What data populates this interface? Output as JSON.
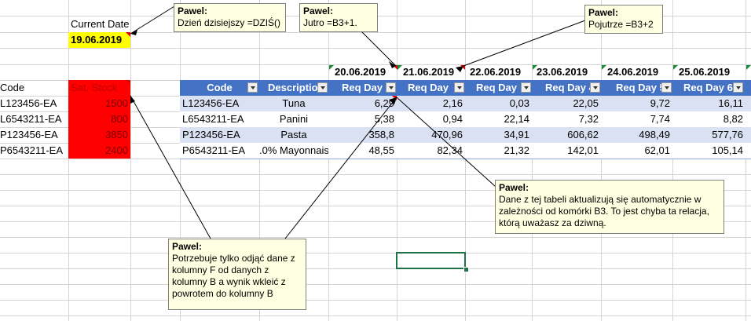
{
  "current_date_label": "Current Date",
  "current_date_value": "19.06.2019",
  "left_table": {
    "headers": [
      "Code",
      "Sat. Stock"
    ],
    "rows": [
      {
        "code": "L123456-EA",
        "stock": "1500"
      },
      {
        "code": "L6543211-EA",
        "stock": "800"
      },
      {
        "code": "P123456-EA",
        "stock": "3850"
      },
      {
        "code": "P6543211-EA",
        "stock": "2400"
      }
    ]
  },
  "dates": [
    "20.06.2019",
    "21.06.2019",
    "22.06.2019",
    "23.06.2019",
    "24.06.2019",
    "25.06.2019"
  ],
  "main_table": {
    "headers": [
      "Code",
      "Descriptio",
      "Req Day",
      "Req Day",
      "Req Day",
      "Req Day 4",
      "Req Day 5",
      "Req Day 6"
    ],
    "rows": [
      {
        "code": "L123456-EA",
        "desc": "Tuna",
        "vals": [
          "6,29",
          "2,16",
          "0,03",
          "22,05",
          "9,72",
          "16,11"
        ]
      },
      {
        "code": "L6543211-EA",
        "desc": "Panini",
        "vals": [
          "5,38",
          "0,94",
          "22,14",
          "7,32",
          "7,74",
          "8,82"
        ]
      },
      {
        "code": "P123456-EA",
        "desc": "Pasta",
        "vals": [
          "358,8",
          "470,96",
          "34,91",
          "606,62",
          "498,49",
          "577,76"
        ]
      },
      {
        "code": "P6543211-EA",
        "desc": ".0% Mayonnais",
        "vals": [
          "48,55",
          "82,34",
          "21,32",
          "142,01",
          "62,01",
          "105,14"
        ]
      }
    ]
  },
  "comments": [
    {
      "author": "Pawel:",
      "text": "Dzień dzisiejszy =DZIŚ()"
    },
    {
      "author": "Pawel:",
      "text": "Jutro =B3+1."
    },
    {
      "author": "Pawel:",
      "text": "Pojutrze =B3+2"
    },
    {
      "author": "Pawel:",
      "text": "Dane z tej tabeli aktualizują się automatycznie w zależności od komórki B3. To jest chyba ta relacja, którą uważasz za dziwną."
    },
    {
      "author": "Pawel:",
      "text": "Potrzebuje tylko odjąć dane z kolumny F od danych z kolumny B a wynik wkleić z powrotem do kolumny B"
    }
  ],
  "colors": {
    "header_blue": "#4472c4",
    "band_blue": "#d9e1f2",
    "stock_red": "#ff0000",
    "date_yellow": "#ffff00",
    "note_bg": "#ffffe1",
    "selection_green": "#217346"
  }
}
